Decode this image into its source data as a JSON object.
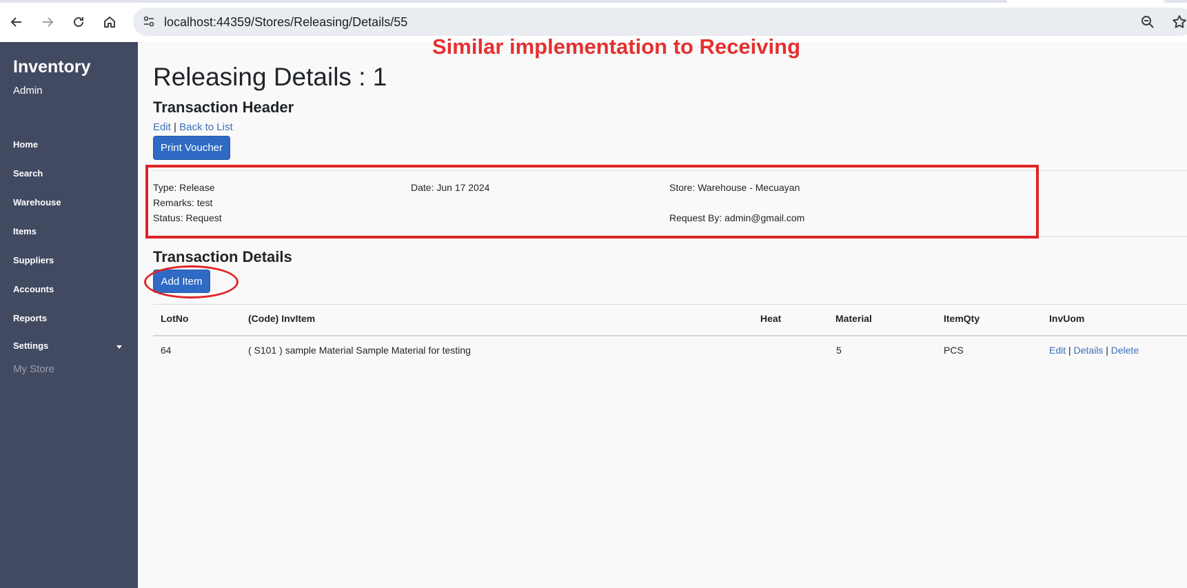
{
  "browser": {
    "url": "localhost:44359/Stores/Releasing/Details/55",
    "icons": [
      "back-arrow-icon",
      "forward-arrow-icon",
      "reload-icon",
      "home-icon",
      "site-info-icon",
      "zoom-icon",
      "bookmark-star-icon"
    ]
  },
  "sidebar": {
    "brand": "Inventory",
    "role": "Admin",
    "items": [
      {
        "label": "Home"
      },
      {
        "label": "Search"
      },
      {
        "label": "Warehouse"
      },
      {
        "label": "Items"
      },
      {
        "label": "Suppliers"
      },
      {
        "label": "Accounts"
      },
      {
        "label": "Reports"
      },
      {
        "label": "Settings"
      }
    ],
    "store": "My Store"
  },
  "annotation": "Similar implementation to Receiving",
  "page": {
    "title": "Releasing Details : 1",
    "header_section": "Transaction Header",
    "edit_link": "Edit",
    "separator": "|",
    "back_link": "Back to List",
    "print_button": "Print Voucher"
  },
  "header_info": {
    "type": "Type: Release",
    "date": "Date: Jun 17 2024",
    "store": "Store: Warehouse - Mecuayan",
    "remarks": "Remarks: test",
    "status": "Status: Request",
    "request_by": "Request By: admin@gmail.com"
  },
  "details": {
    "section": "Transaction Details",
    "add_button": "Add Item",
    "columns": [
      "LotNo",
      "(Code) InvItem",
      "Heat",
      "Material",
      "ItemQty",
      "InvUom"
    ],
    "rows": [
      {
        "lotno": "64",
        "invitem": "( S101 ) sample Material Sample Material for testing",
        "heat": "",
        "material": "5",
        "itemqty": "PCS",
        "actions": {
          "edit": "Edit",
          "details": "Details",
          "delete": "Delete"
        }
      }
    ]
  },
  "colors": {
    "sidebar": "#424a61",
    "primary_button": "#2f6bc4",
    "link": "#3a6fb7",
    "annotation_red": "#e53030"
  }
}
